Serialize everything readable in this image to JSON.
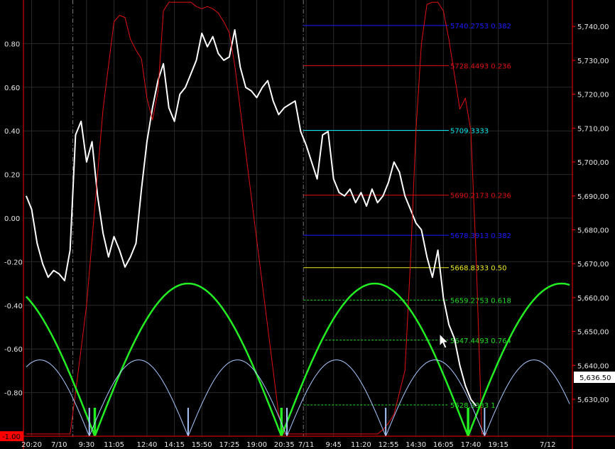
{
  "chart_data": {
    "type": "line",
    "left_axis": {
      "min": -1.0,
      "max": 1.0,
      "ticks": [
        "0.80",
        "0.60",
        "0.40",
        "0.20",
        "0.00",
        "-0.20",
        "-0.40",
        "-0.60",
        "-0.80"
      ],
      "bottom_label": "-1.00",
      "bottom_label_color": "#ff0000"
    },
    "right_axis": {
      "min": 5619.1,
      "max": 5747.8,
      "ticks": [
        "5,740,00",
        "5,730,00",
        "5,720,00",
        "5,710,00",
        "5,700,00",
        "5,690,00",
        "5,680,00",
        "5,670,00",
        "5,660,00",
        "5,650,00",
        "5,640,00",
        "5,630,00"
      ],
      "current_value_label": "5,636.50",
      "current_value": 5636.5
    },
    "x_axis": {
      "n": 100,
      "labels": [
        {
          "i": 1,
          "text": "20:20"
        },
        {
          "i": 6,
          "text": "7/10"
        },
        {
          "i": 11,
          "text": "9:30"
        },
        {
          "i": 16,
          "text": "11:05"
        },
        {
          "i": 22,
          "text": "12:40"
        },
        {
          "i": 27,
          "text": "14:15"
        },
        {
          "i": 32,
          "text": "15:50"
        },
        {
          "i": 37,
          "text": "17:25"
        },
        {
          "i": 42,
          "text": "19:00"
        },
        {
          "i": 47,
          "text": "20:35"
        },
        {
          "i": 51,
          "text": "7/11"
        },
        {
          "i": 56,
          "text": "9:45"
        },
        {
          "i": 61,
          "text": "11:20"
        },
        {
          "i": 66,
          "text": "12:55"
        },
        {
          "i": 71,
          "text": "14:30"
        },
        {
          "i": 76,
          "text": "16:05"
        },
        {
          "i": 81,
          "text": "17:40"
        },
        {
          "i": 86,
          "text": "19:15"
        },
        {
          "i": 95,
          "text": "7/12"
        }
      ],
      "session_breaks": [
        9,
        51
      ]
    },
    "grid": true,
    "series": [
      {
        "key": "price",
        "axis": "right",
        "color": "#ffffff",
        "width": 2,
        "start": 0,
        "values": [
          5690,
          5686,
          5676,
          5670,
          5666,
          5668,
          5667,
          5665,
          5674,
          5708,
          5712,
          5700,
          5706,
          5690,
          5679,
          5672,
          5678,
          5674,
          5669,
          5672,
          5676,
          5692,
          5706,
          5716,
          5724,
          5729,
          5716,
          5712,
          5720,
          5722,
          5726,
          5730,
          5738,
          5734,
          5737,
          5732,
          5730,
          5731,
          5739,
          5728,
          5722,
          5721,
          5719,
          5722,
          5724,
          5718,
          5714,
          5716,
          5717,
          5718,
          5709,
          5705,
          5700,
          5695,
          5708,
          5709,
          5695,
          5691,
          5690,
          5692,
          5688,
          5691,
          5687,
          5692,
          5688,
          5690,
          5694,
          5700,
          5697,
          5690,
          5686,
          5682,
          5680,
          5672,
          5666,
          5674,
          5660,
          5652,
          5648,
          5640,
          5634,
          5630,
          5628
        ]
      },
      {
        "key": "red-oscillator",
        "axis": "left",
        "color": "#e01010",
        "width": 1,
        "start": 0,
        "values": [
          -0.99,
          -0.99,
          -0.99,
          -0.99,
          -0.99,
          -0.99,
          -0.99,
          -0.99,
          -0.99,
          -0.8,
          -0.6,
          -0.4,
          -0.1,
          0.2,
          0.5,
          0.7,
          0.9,
          0.93,
          0.92,
          0.82,
          0.77,
          0.73,
          0.55,
          0.45,
          0.58,
          0.95,
          0.99,
          0.99,
          0.99,
          0.99,
          0.99,
          0.97,
          0.96,
          0.97,
          0.96,
          0.94,
          0.9,
          0.85,
          0.7,
          0.5,
          0.3,
          0.1,
          -0.1,
          -0.3,
          -0.5,
          -0.7,
          -0.9,
          -0.99,
          -0.99,
          -0.99,
          -0.99,
          -0.99,
          -0.99,
          -0.99,
          -0.99,
          -0.99,
          -0.99,
          -0.99,
          -0.99,
          -0.99,
          -0.99,
          -0.99,
          -0.99,
          -0.99,
          -0.99,
          -0.97,
          -0.94,
          -0.9,
          -0.8,
          -0.7,
          -0.2,
          0.4,
          0.8,
          0.98,
          0.99,
          0.99,
          0.95,
          0.82,
          0.66,
          0.5,
          0.55,
          0.4,
          -0.2,
          -0.99,
          -0.99
        ]
      },
      {
        "key": "green-cycle",
        "axis": "left",
        "color": "#22ee22",
        "width": 2.5,
        "kind": "arches",
        "zeros": [
          12.5,
          46.5,
          80.5
        ],
        "period": 34,
        "base": -1.0,
        "peak": -0.3,
        "xmin": 0,
        "xmax": 99
      },
      {
        "key": "blue-cycle",
        "axis": "left",
        "color": "#a8c8ff",
        "width": 1,
        "kind": "arches",
        "zeros": [
          11.5,
          29.5,
          47.5,
          65.5,
          83.5
        ],
        "period": 18,
        "base": -1.0,
        "peak": -0.65,
        "xmin": 0,
        "xmax": 99
      }
    ],
    "fib_levels": [
      {
        "value": 5740.2753,
        "label": "5740.2753 0.382",
        "color": "#1a1aff",
        "dashed": false,
        "x_start": 51
      },
      {
        "value": 5728.4493,
        "label": "5728.4493 0.236",
        "color": "#e01010",
        "dashed": false,
        "x_start": 51
      },
      {
        "value": 5709.3333,
        "label": "5709.3333",
        "color": "#00e5ee",
        "dashed": false,
        "x_start": 51
      },
      {
        "value": 5690.2173,
        "label": "5690.2173 0.236",
        "color": "#e01010",
        "dashed": false,
        "x_start": 51
      },
      {
        "value": 5678.3913,
        "label": "5678.3913 0.382",
        "color": "#1a1aff",
        "dashed": false,
        "x_start": 51
      },
      {
        "value": 5668.8333,
        "label": "5668.8333 0.50",
        "color": "#eeee22",
        "dashed": false,
        "x_start": 51
      },
      {
        "value": 5659.2753,
        "label": "5659.2753 0.618",
        "color": "#22dd22",
        "dashed": true,
        "x_start": 51
      },
      {
        "value": 5647.4493,
        "label": "5647.4493 0.764",
        "color": "#22dd22",
        "dashed": true,
        "x_start": 55
      },
      {
        "value": 5628.3333,
        "label": "5628.3333 1",
        "color": "#22dd22",
        "dashed": true,
        "x_start": 51
      }
    ],
    "colors": {
      "background": "#000000",
      "frame": "#ff0000",
      "grid": "#2a2a2a",
      "axis_text": "#e6e6e6",
      "current_value_box": "#ffffff",
      "current_value_text": "#000000"
    },
    "cursor_icon": "mouse-pointer-icon"
  }
}
